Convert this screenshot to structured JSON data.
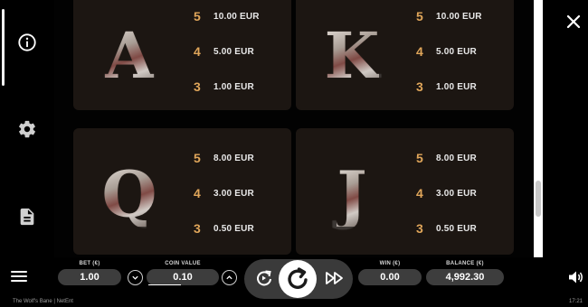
{
  "side_menu": {
    "items": [
      {
        "name": "info",
        "icon": "info-icon"
      },
      {
        "name": "settings",
        "icon": "gear-icon"
      },
      {
        "name": "rules",
        "icon": "document-icon"
      }
    ]
  },
  "paytable": {
    "cards": [
      {
        "symbol": "A",
        "payouts": [
          {
            "count": "5",
            "amount": "10.00 EUR"
          },
          {
            "count": "4",
            "amount": "5.00 EUR"
          },
          {
            "count": "3",
            "amount": "1.00 EUR"
          }
        ]
      },
      {
        "symbol": "K",
        "payouts": [
          {
            "count": "5",
            "amount": "10.00 EUR"
          },
          {
            "count": "4",
            "amount": "5.00 EUR"
          },
          {
            "count": "3",
            "amount": "1.00 EUR"
          }
        ]
      },
      {
        "symbol": "Q",
        "payouts": [
          {
            "count": "5",
            "amount": "8.00 EUR"
          },
          {
            "count": "4",
            "amount": "3.00 EUR"
          },
          {
            "count": "3",
            "amount": "0.50 EUR"
          }
        ]
      },
      {
        "symbol": "J",
        "payouts": [
          {
            "count": "5",
            "amount": "8.00 EUR"
          },
          {
            "count": "4",
            "amount": "3.00 EUR"
          },
          {
            "count": "3",
            "amount": "0.50 EUR"
          }
        ]
      }
    ]
  },
  "controls": {
    "bet_label": "BET (€)",
    "bet_value": "1.00",
    "coin_label": "COIN VALUE",
    "coin_value": "0.10",
    "win_label": "WIN (€)",
    "win_value": "0.00",
    "balance_label": "BALANCE (€)",
    "balance_value": "4,992.30"
  },
  "footer": {
    "game_name": "The Wolf's Bane  |  NetEnt",
    "time": "17:21"
  },
  "colors": {
    "payout_count": "#e0a65a",
    "card_bg": "#1c1612",
    "pill_bg": "#3d3d3d"
  }
}
